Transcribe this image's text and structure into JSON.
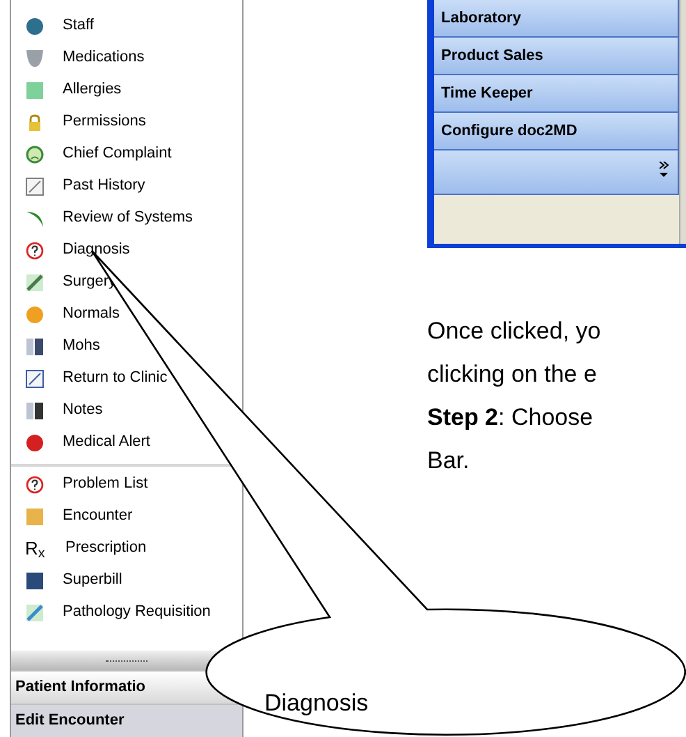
{
  "sidebar": {
    "groups": [
      {
        "items": [
          {
            "label": "Staff"
          },
          {
            "label": "Medications"
          },
          {
            "label": "Allergies"
          },
          {
            "label": "Permissions"
          },
          {
            "label": "Chief Complaint"
          },
          {
            "label": "Past History"
          },
          {
            "label": "Review of Systems"
          },
          {
            "label": "Diagnosis"
          },
          {
            "label": "Surgery"
          },
          {
            "label": "Normals"
          },
          {
            "label": "Mohs"
          },
          {
            "label": "Return to Clinic"
          },
          {
            "label": "Notes"
          },
          {
            "label": "Medical Alert"
          }
        ]
      },
      {
        "items": [
          {
            "label": "Problem List"
          },
          {
            "label": "Encounter"
          },
          {
            "label": "Prescription",
            "glyph": "R$_{x}$"
          },
          {
            "label": "Superbill"
          },
          {
            "label": "Pathology Requisition"
          }
        ]
      }
    ]
  },
  "nav_bars": [
    {
      "label": "Patient Informatio",
      "selected": false
    },
    {
      "label": "Edit Encounter",
      "selected": true
    }
  ],
  "nav_panel": {
    "buttons": [
      "Laboratory",
      "Product Sales",
      "Time Keeper",
      "Configure doc2MD"
    ]
  },
  "document": {
    "lines": [
      {
        "text": "Once clicked, yo"
      },
      {
        "text": "clicking on the e"
      },
      {
        "text": "**Step 2**: Choose"
      },
      {
        "text": "Bar."
      }
    ]
  },
  "callout": {
    "label": "Diagnosis"
  }
}
